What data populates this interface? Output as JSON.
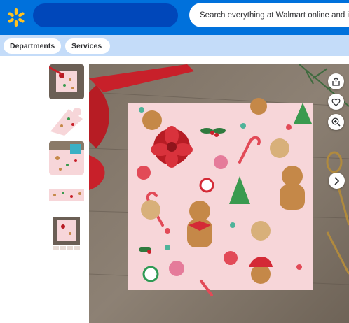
{
  "header": {
    "logo_icon": "walmart-spark-icon",
    "search": {
      "placeholder": "Search everything at Walmart online and in store"
    }
  },
  "subnav": {
    "departments_label": "Departments",
    "services_label": "Services"
  },
  "gallery": {
    "thumbnail_count": 5,
    "selected_thumbnail": 1,
    "action_icons": [
      "share-icon",
      "heart-icon",
      "zoom-in-icon"
    ],
    "next_icon": "chevron-right-icon"
  },
  "colors": {
    "brand_blue": "#0071dc",
    "dark_blue": "#0047ba",
    "spark_yellow": "#ffc220",
    "subnav_bg": "#c4dcf9",
    "wrap_pink": "#f7d6d9",
    "ribbon_red": "#c8202a"
  }
}
